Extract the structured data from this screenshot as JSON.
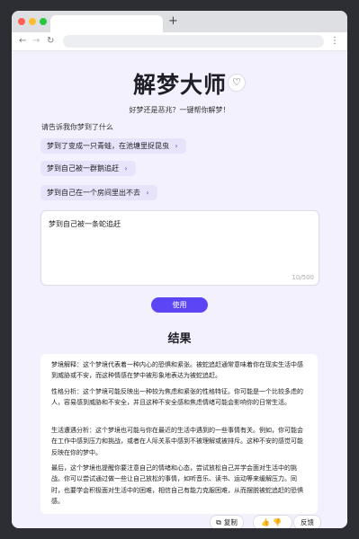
{
  "browser": {
    "new_tab": "+",
    "back": "←",
    "forward": "→",
    "reload": "↻",
    "menu": "⋮"
  },
  "page": {
    "title": "解梦大师",
    "heart_icon": "♡",
    "subtitle": "好梦还是恶兆？一键帮你解梦！",
    "prompt_label": "请告诉我你梦到了什么",
    "examples": [
      "梦到了变成一只青蛙，在池塘里捉昆虫",
      "梦到自己被一群鹅追赶",
      "梦到自己在一个房间里出不去"
    ],
    "chip_arrow": "›",
    "input_value": "梦到自己被一条蛇追赶",
    "counter": "10/500",
    "use_button": "使用",
    "result_title": "结果",
    "result_paragraphs": [
      "梦境解释：这个梦境代表着一种内心的恐惧和紧张。被蛇追赶通常意味着你在现实生活中感到威胁或不安，而这种情感在梦中被形象地表达为被蛇追赶。",
      "性格分析：这个梦境可能反映出一种较为焦虑和紧张的性格特征。你可能是一个比较多虑的人，容易感到威胁和不安全，并且这种不安全感和焦虑情绪可能会影响你的日常生活。",
      "生活遭遇分析：这个梦境也可能与你在最近的生活中遇到的一些事情有关。例如，你可能会在工作中感到压力和挑战，或者在人际关系中感到不被理解或被排斥。这种不安的感觉可能反映在你的梦中。",
      "最后，这个梦境也提醒你要注意自己的情绪和心态，尝试放松自己并学会面对生活中的挑战。你可以尝试通过做一些让自己放松的事情，如听音乐、读书、运动等来缓解压力。同时，也要学会积极面对生活中的困难，相信自己有能力克服困难，从而摆脱被蛇追赶的恐惧感。"
    ],
    "actions": {
      "copy_icon": "⧉",
      "copy": "复制",
      "like_icon": "👍",
      "dislike_icon": "👎",
      "feedback": "反馈"
    }
  },
  "colors": {
    "accent": "#5b45f5",
    "chip_bg": "#e6e3fb",
    "page_bg": "#f2f1fd"
  }
}
